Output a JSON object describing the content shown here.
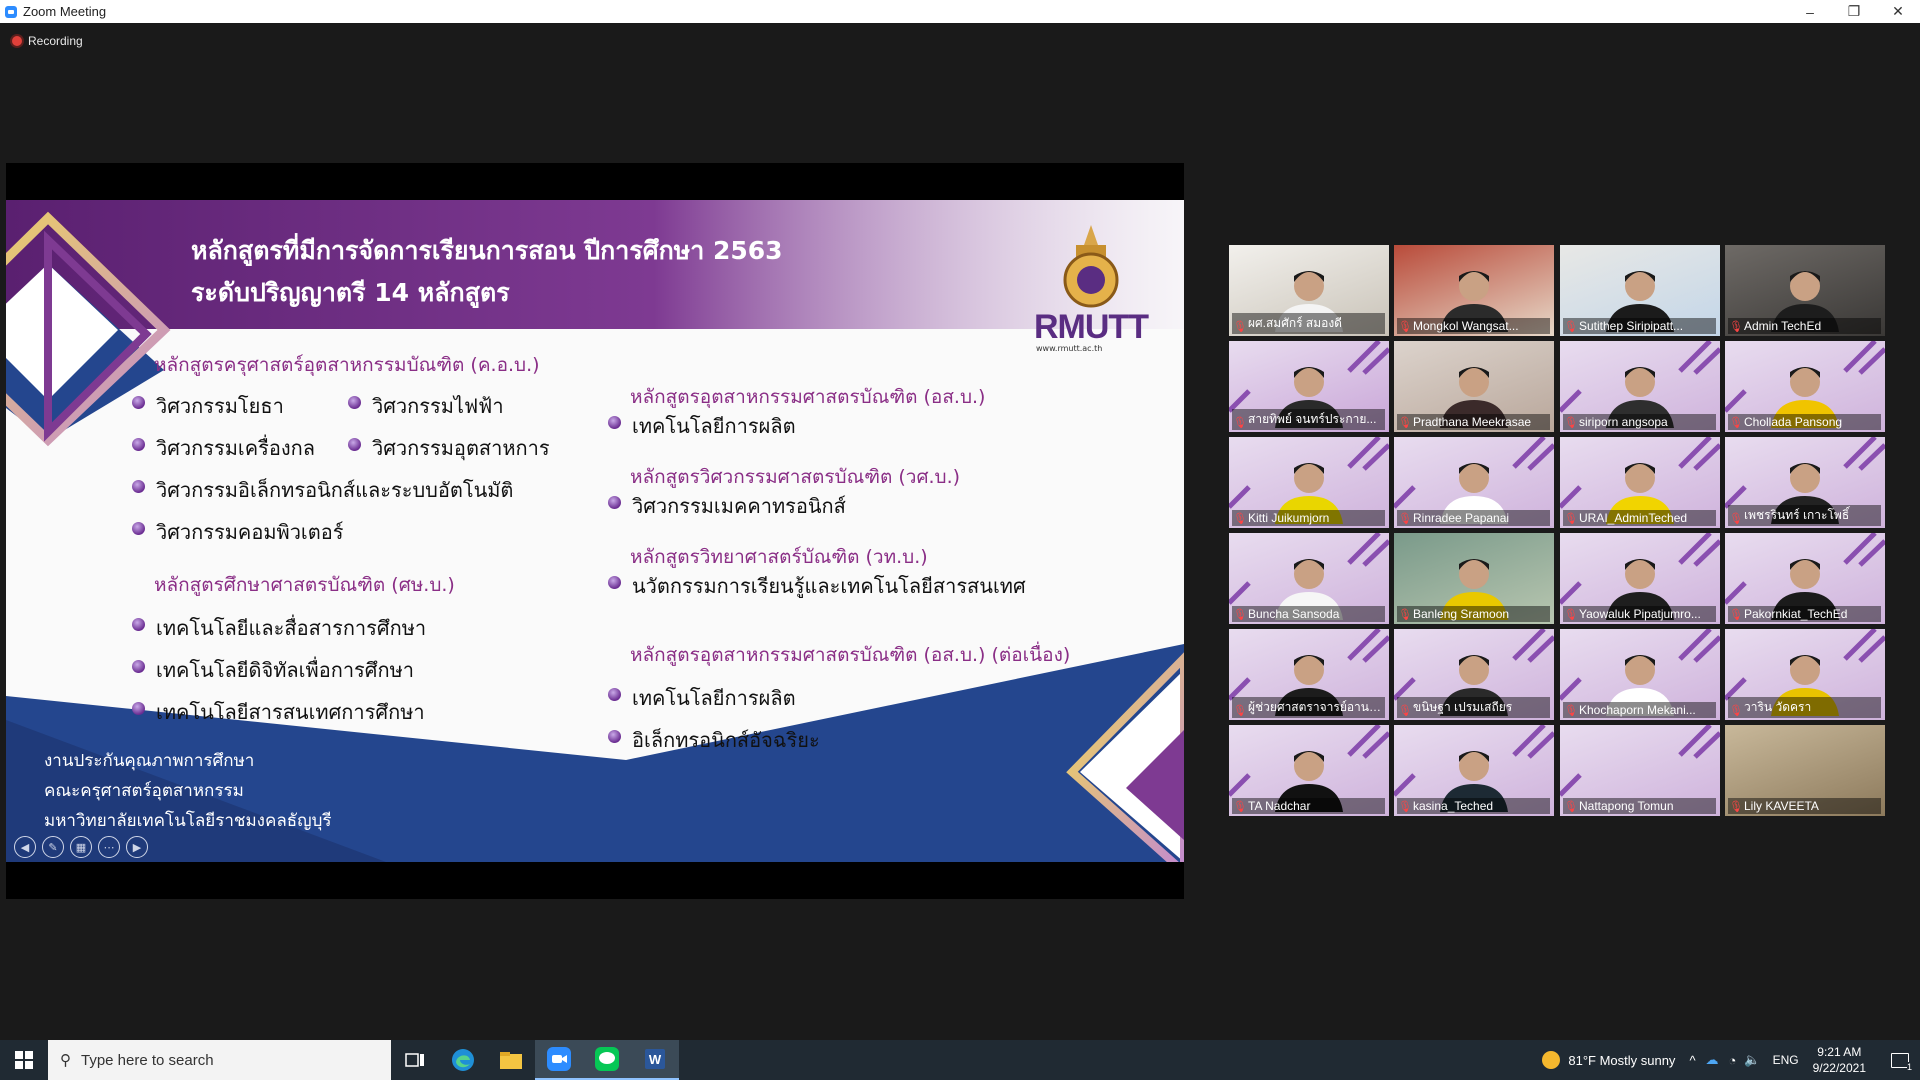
{
  "window": {
    "title": "Zoom Meeting",
    "minimize": "–",
    "restore": "❐",
    "close": "✕"
  },
  "recording": {
    "label": "Recording"
  },
  "slide": {
    "title_line1": "หลักสูตรที่มีการจัดการเรียนการสอน ปีการศึกษา 2563",
    "title_line2": "ระดับปริญญาตรี  14 หลักสูตร",
    "logo_text": "RMUTT",
    "logo_url": "www.rmutt.ac.th",
    "left_group1_heading": "หลักสูตรครุศาสตร์อุตสาหกรรมบัณฑิต (ค.อ.บ.)",
    "left_group1_items": [
      "วิศวกรรมโยธา",
      "วิศวกรรมไฟฟ้า",
      "วิศวกรรมเครื่องกล",
      "วิศวกรรมอุตสาหการ",
      "วิศวกรรมอิเล็กทรอนิกส์และระบบอัตโนมัติ",
      "วิศวกรรมคอมพิวเตอร์"
    ],
    "left_group2_heading": "หลักสูตรศึกษาศาสตรบัณฑิต (ศษ.บ.)",
    "left_group2_items": [
      "เทคโนโลยีและสื่อสารการศึกษา",
      "เทคโนโลยีดิจิทัลเพื่อการศึกษา",
      "เทคโนโลยีสารสนเทศการศึกษา"
    ],
    "right_groups": [
      {
        "heading": "หลักสูตรอุตสาหกรรมศาสตรบัณฑิต (อส.บ.)",
        "items": [
          "เทคโนโลยีการผลิต"
        ]
      },
      {
        "heading": "หลักสูตรวิศวกรรมศาสตรบัณฑิต (วศ.บ.)",
        "items": [
          "วิศวกรรมเมคคาทรอนิกส์"
        ]
      },
      {
        "heading": "หลักสูตรวิทยาศาสตร์บัณฑิต (วท.บ.)",
        "items": [
          "นวัตกรรมการเรียนรู้และเทคโนโลยีสารสนเทศ"
        ]
      },
      {
        "heading": "หลักสูตรอุตสาหกรรมศาสตรบัณฑิต (อส.บ.) (ต่อเนื่อง)",
        "items": [
          "เทคโนโลยีการผลิต",
          "อิเล็กทรอนิกส์อัจฉริยะ"
        ]
      }
    ],
    "footer": [
      "งานประกันคุณภาพการศึกษา",
      "คณะครุศาสตร์อุตสาหกรรม",
      "มหาวิทยาลัยเทคโนโลยีราชมงคลธัญบุรี"
    ]
  },
  "participants": [
    "ผศ.สมศักร์ สมองดี",
    "Mongkol Wangsat...",
    "Sutithep Siripipatt...",
    "Admin TechEd",
    "สายทิพย์ จนทร์ประกาย...",
    "Pradthana Meekrasae",
    "siriporn angsopa",
    "Chollada Pansong",
    "Kitti Juikumjorn",
    "Rinradee Papanai",
    "URAI_AdminTeched",
    "เพชรรินทร์ เกาะโพธิ์",
    "Buncha Sansoda",
    "Banleng Sramoon",
    "Yaowaluk Pipatjumro...",
    "Pakornkiat_TechEd",
    "ผู้ช่วยศาสตราจารย์อานน...",
    "ขนิษฐา เปรมเสถียร",
    "Khochaporn Mekani...",
    "วาริน วัดครา",
    "TA Nadchar",
    "kasina_Teched",
    "Nattapong Tomun",
    "Lily KAVEETA"
  ],
  "taskbar": {
    "search_placeholder": "Type here to search",
    "weather": "81°F  Mostly sunny",
    "lang": "ENG",
    "time": "9:21 AM",
    "date": "9/22/2021",
    "notif_count": "1"
  },
  "colors": {
    "accent_purple": "#6b2c85",
    "slide_blue": "#24468e",
    "gold": "#e6c84a"
  }
}
